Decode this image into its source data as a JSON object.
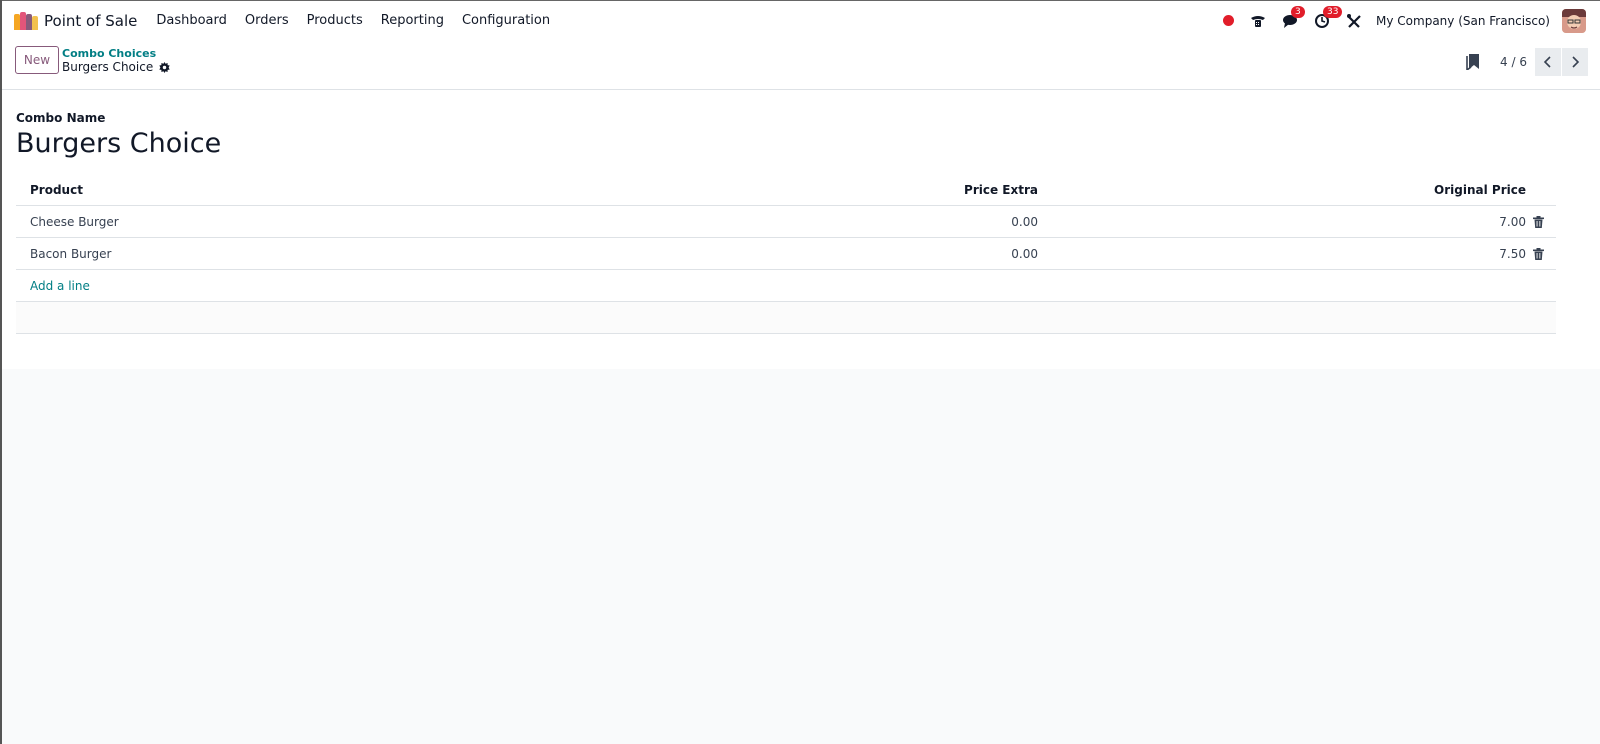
{
  "navbar": {
    "app_name": "Point of Sale",
    "menu": [
      "Dashboard",
      "Orders",
      "Products",
      "Reporting",
      "Configuration"
    ],
    "messages_count": "3",
    "activities_count": "33",
    "company": "My Company (San Francisco)"
  },
  "control_panel": {
    "new_label": "New",
    "breadcrumb_parent": "Combo Choices",
    "breadcrumb_current": "Burgers Choice",
    "pager_value": "4 / 6"
  },
  "form": {
    "name_label": "Combo Name",
    "name_value": "Burgers Choice",
    "table": {
      "headers": {
        "product": "Product",
        "price_extra": "Price Extra",
        "original_price": "Original Price"
      },
      "rows": [
        {
          "product": "Cheese Burger",
          "price_extra": "0.00",
          "original_price": "7.00"
        },
        {
          "product": "Bacon Burger",
          "price_extra": "0.00",
          "original_price": "7.50"
        }
      ],
      "add_line": "Add a line"
    }
  },
  "colors": {
    "brand": "#875a7b",
    "link": "#017e84",
    "badge": "#e11d2a"
  },
  "icons": [
    "pos-app-icon",
    "recording-icon",
    "phone-icon",
    "chat-icon",
    "activity-clock-icon",
    "debug-tools-icon",
    "gear-icon",
    "bookmark-icon",
    "chevron-left-icon",
    "chevron-right-icon",
    "trash-icon"
  ]
}
